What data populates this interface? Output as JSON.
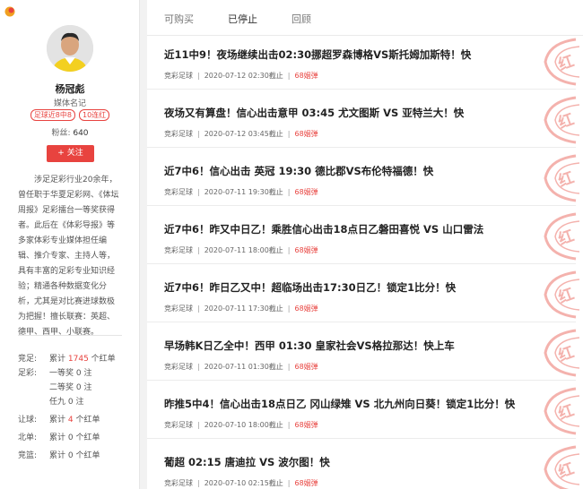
{
  "colors": {
    "accent": "#e8433f",
    "stamp": "#f4b2ad"
  },
  "profile": {
    "name": "杨冠彪",
    "role": "媒体名记",
    "badges": [
      "足球近8中8",
      "10连红"
    ],
    "fans_label": "粉丝:",
    "fans_count": "640",
    "follow_label": "+ 关注",
    "bio": "涉足足彩行业20余年，曾任职于华夏足彩网、《体坛周报》足彩擂台一等奖获得者。此后在《体彩导报》等多家体彩专业媒体担任编辑、推介专家、主持人等，具有丰富的足彩专业知识经验；精通各种数据变化分析，尤其是对比赛进球数极为把握！擅长联赛：英超、德甲、西甲、小联赛。"
  },
  "stats": [
    {
      "label": "竞足:",
      "pre": "累计",
      "num": "1745",
      "post": "个红单"
    },
    {
      "label": "足彩:",
      "pre": "一等奖",
      "num": "0",
      "post": "注"
    },
    {
      "label": "",
      "pre": "二等奖",
      "num": "0",
      "post": "注"
    },
    {
      "label": "",
      "pre": "任九",
      "num": "0",
      "post": "注"
    },
    {
      "label": "让球:",
      "pre": "累计",
      "num": "4",
      "post": "个红单"
    },
    {
      "label": "北单:",
      "pre": "累计",
      "num": "0",
      "post": "个红单"
    },
    {
      "label": "竞篮:",
      "pre": "累计",
      "num": "0",
      "post": "个红单"
    }
  ],
  "tabs": [
    "可购买",
    "已停止",
    "回顾"
  ],
  "active_tab": "已停止",
  "stamp_text": "红",
  "articles": [
    {
      "title": "近11中9！夜场继续出击02:30挪超罗森博格VS斯托姆加斯特！快",
      "category": "竞彩足球",
      "deadline": "2020-07-12 02:30截止",
      "price": "68姻弹"
    },
    {
      "title": "夜场又有算盘！信心出击意甲 03:45 尤文图斯 VS 亚特兰大！快",
      "category": "竞彩足球",
      "deadline": "2020-07-12 03:45截止",
      "price": "68姻弹"
    },
    {
      "title": "近7中6！信心出击 英冠 19:30 德比郡VS布伦特福德！快",
      "category": "竞彩足球",
      "deadline": "2020-07-11 19:30截止",
      "price": "68姻弹"
    },
    {
      "title": "近7中6！昨又中日乙！乘胜信心出击18点日乙磐田喜悦 VS 山口雷法",
      "category": "竞彩足球",
      "deadline": "2020-07-11 18:00截止",
      "price": "68姻弹"
    },
    {
      "title": "近7中6！昨日乙又中！超临场出击17:30日乙！锁定1比分！快",
      "category": "竞彩足球",
      "deadline": "2020-07-11 17:30截止",
      "price": "68姻弹"
    },
    {
      "title": "早场韩K日乙全中！西甲 01:30 皇家社会VS格拉那达！快上车",
      "category": "竞彩足球",
      "deadline": "2020-07-11 01:30截止",
      "price": "68姻弹"
    },
    {
      "title": "昨推5中4！信心出击18点日乙 冈山绿雉 VS 北九州向日葵！锁定1比分！快",
      "category": "竞彩足球",
      "deadline": "2020-07-10 18:00截止",
      "price": "68姻弹"
    },
    {
      "title": "葡超 02:15 唐迪拉 VS 波尔图！快",
      "category": "竞彩足球",
      "deadline": "2020-07-10 02:15截止",
      "price": "68姻弹"
    }
  ]
}
